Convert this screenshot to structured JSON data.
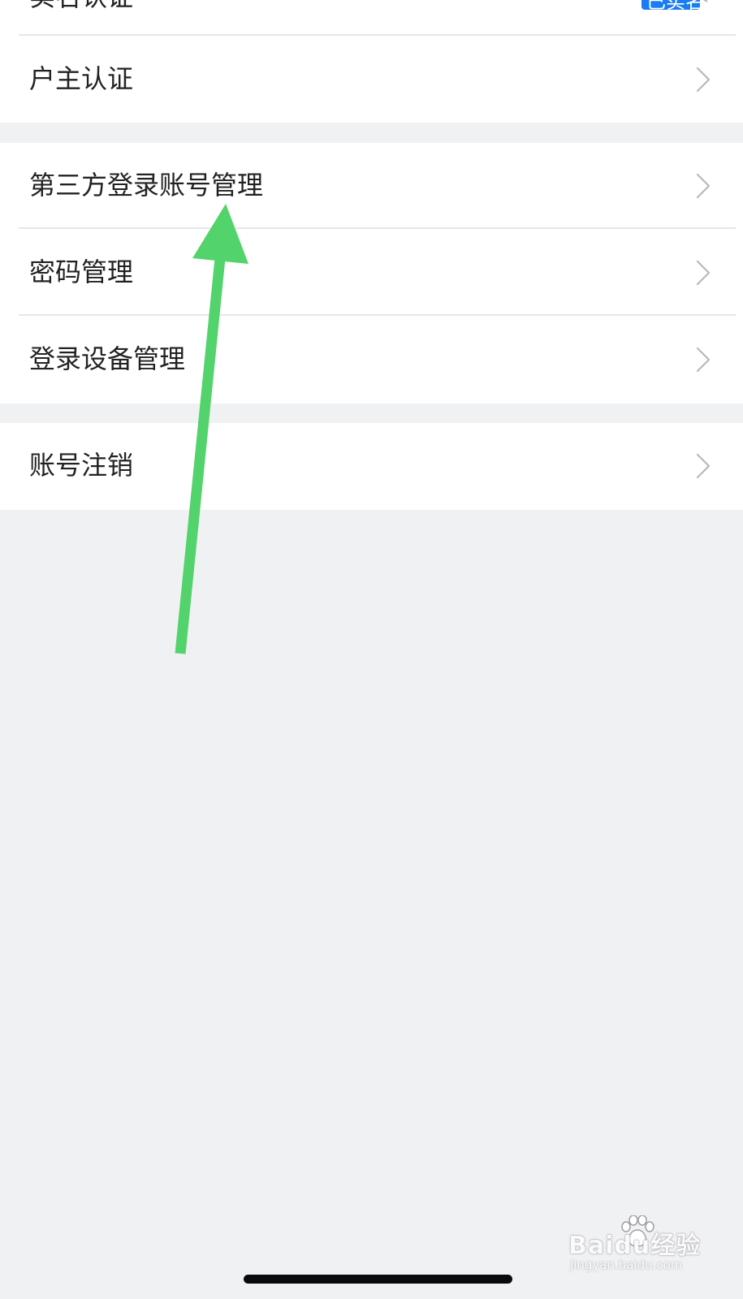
{
  "settings": {
    "top_partial": {
      "label": "实名认证",
      "value": "铝",
      "badge": "已实名"
    },
    "group1": [
      {
        "label": "户主认证"
      }
    ],
    "group2": [
      {
        "label": "第三方登录账号管理"
      },
      {
        "label": "密码管理"
      },
      {
        "label": "登录设备管理"
      }
    ],
    "group3": [
      {
        "label": "账号注销"
      }
    ]
  },
  "annotation": {
    "arrow_color": "#52d36b"
  },
  "watermark": {
    "brand": "Baidu经验",
    "url": "jingyan.baidu.com"
  },
  "colors": {
    "background": "#f0f1f3",
    "card": "#ffffff",
    "badge": "#1a7cf2",
    "text": "#222222",
    "chevron": "#b8b8bd"
  }
}
